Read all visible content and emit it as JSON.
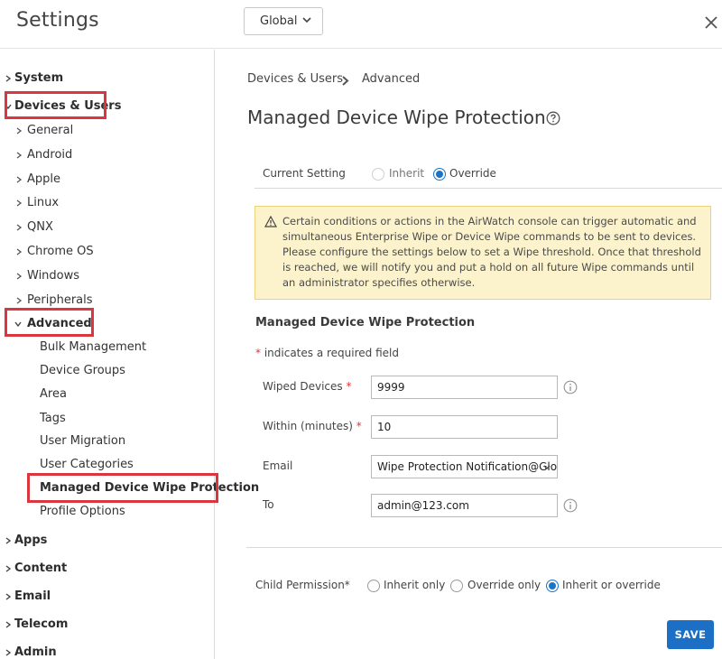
{
  "header": {
    "title": "Settings",
    "scope_label": "Global"
  },
  "sidebar": {
    "sections": [
      {
        "label": "System",
        "expanded": false
      },
      {
        "label": "Devices & Users",
        "expanded": true
      },
      {
        "label": "Apps",
        "expanded": false
      },
      {
        "label": "Content",
        "expanded": false
      },
      {
        "label": "Email",
        "expanded": false
      },
      {
        "label": "Telecom",
        "expanded": false
      },
      {
        "label": "Admin",
        "expanded": false
      }
    ],
    "devices_users_items": [
      {
        "label": "General"
      },
      {
        "label": "Android"
      },
      {
        "label": "Apple"
      },
      {
        "label": "Linux"
      },
      {
        "label": "QNX"
      },
      {
        "label": "Chrome OS"
      },
      {
        "label": "Windows"
      },
      {
        "label": "Peripherals"
      },
      {
        "label": "Advanced",
        "expanded": true
      }
    ],
    "advanced_items": [
      {
        "label": "Bulk Management"
      },
      {
        "label": "Device Groups"
      },
      {
        "label": "Area"
      },
      {
        "label": "Tags"
      },
      {
        "label": "User Migration"
      },
      {
        "label": "User Categories"
      },
      {
        "label": "Managed Device Wipe Protection",
        "selected": true
      },
      {
        "label": "Profile Options"
      }
    ]
  },
  "breadcrumb": {
    "parent": "Devices & Users",
    "current": "Advanced"
  },
  "page_title": "Managed Device Wipe Protection",
  "current_setting": {
    "label": "Current Setting",
    "options": [
      "Inherit",
      "Override"
    ],
    "selected": "Override"
  },
  "warning": {
    "text": "Certain conditions or actions in the AirWatch console can trigger automatic and simultaneous Enterprise Wipe or Device Wipe commands to be sent to devices. Please configure the settings below to set a Wipe threshold. Once that threshold is reached, we will notify you and put a hold on all future Wipe commands until an administrator specifies otherwise."
  },
  "section": {
    "title": "Managed Device Wipe Protection",
    "required_note": "indicates a required field",
    "required_mark": "*"
  },
  "fields": {
    "wiped_devices": {
      "label": "Wiped Devices",
      "value": "9999"
    },
    "within_minutes": {
      "label": "Within (minutes)",
      "value": "10"
    },
    "email": {
      "label": "Email",
      "value": "Wipe Protection Notification@Glo"
    },
    "to": {
      "label": "To",
      "value": "admin@123.com"
    }
  },
  "child_permission": {
    "label": "Child Permission*",
    "options": [
      "Inherit only",
      "Override only",
      "Inherit or override"
    ],
    "selected": "Inherit or override"
  },
  "save_label": "SAVE",
  "colors": {
    "accent": "#1b6fc5",
    "highlight_box": "#d9363e",
    "warning_bg": "#fcf3cc"
  }
}
